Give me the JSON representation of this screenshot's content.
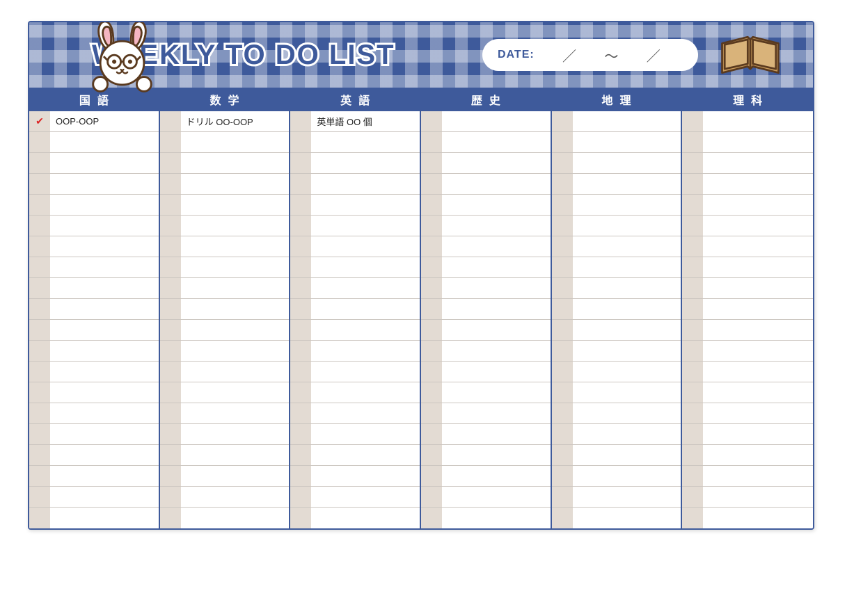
{
  "header": {
    "title": "WEEKLY TO DO LIST",
    "date_label": "DATE:",
    "date_sep1": "／",
    "date_tilde": "〜",
    "date_sep2": "／"
  },
  "rows_per_column": 20,
  "columns": [
    {
      "header": "国語",
      "items": [
        {
          "checked": true,
          "text": "OOP-OOP"
        }
      ]
    },
    {
      "header": "数学",
      "items": [
        {
          "checked": false,
          "text": "ドリル OO-OOP"
        }
      ]
    },
    {
      "header": "英語",
      "items": [
        {
          "checked": false,
          "text": "英単語 OO 個"
        }
      ]
    },
    {
      "header": "歴史",
      "items": []
    },
    {
      "header": "地理",
      "items": []
    },
    {
      "header": "理科",
      "items": []
    }
  ],
  "icons": {
    "check_glyph": "✔"
  }
}
